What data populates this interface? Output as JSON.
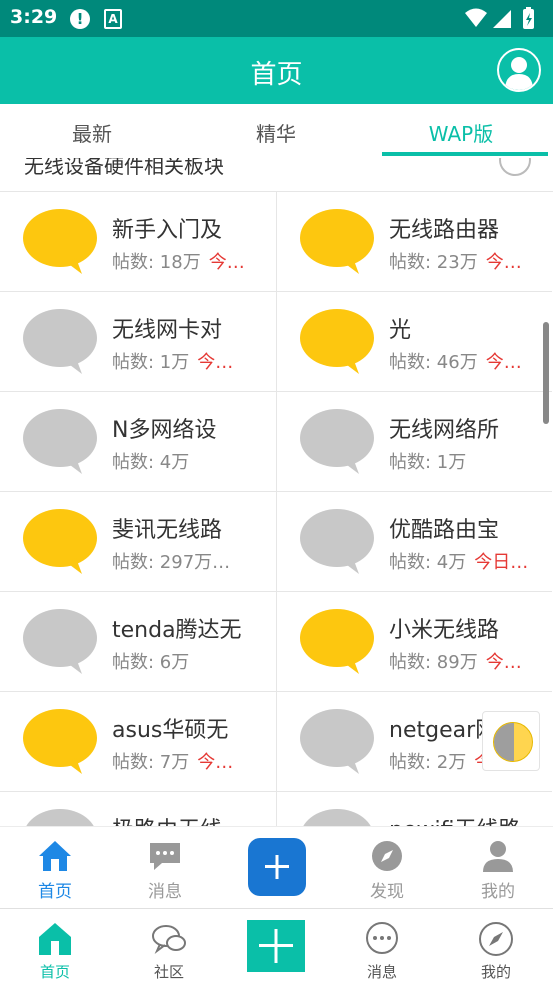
{
  "status_bar": {
    "time": "3:29",
    "alert_glyph": "!",
    "a_glyph": "A"
  },
  "header": {
    "title": "首页"
  },
  "tabs": [
    {
      "label": "最新",
      "active": false
    },
    {
      "label": "精华",
      "active": false
    },
    {
      "label": "WAP版",
      "active": true
    }
  ],
  "partial_row": {
    "text": "无线设备硬件相关板块"
  },
  "forums": [
    {
      "name": "新手入门及",
      "count": "帖数: 18万",
      "today": "今…",
      "color": "yellow"
    },
    {
      "name": "无线路由器",
      "count": "帖数: 23万",
      "today": "今…",
      "color": "yellow"
    },
    {
      "name": "无线网卡对",
      "count": "帖数: 1万",
      "today": "今…",
      "color": "gray"
    },
    {
      "name": "光",
      "count": "帖数: 46万",
      "today": "今…",
      "color": "yellow"
    },
    {
      "name": "N多网络设",
      "count": "帖数: 4万",
      "today": "",
      "color": "gray"
    },
    {
      "name": "无线网络所",
      "count": "帖数: 1万",
      "today": "",
      "color": "gray"
    },
    {
      "name": "斐讯无线路",
      "count": "帖数: 297万…",
      "today": "",
      "color": "yellow"
    },
    {
      "name": "优酷路由宝",
      "count": "帖数: 4万",
      "today": "今日…",
      "color": "gray"
    },
    {
      "name": "tenda腾达无",
      "count": "帖数: 6万",
      "today": "",
      "color": "gray"
    },
    {
      "name": "小米无线路",
      "count": "帖数: 89万",
      "today": "今…",
      "color": "yellow"
    },
    {
      "name": "asus华硕无",
      "count": "帖数: 7万",
      "today": "今…",
      "color": "yellow"
    },
    {
      "name": "netgear网件",
      "count": "帖数: 2万",
      "today": "今日…",
      "color": "gray"
    },
    {
      "name": "极路由无线",
      "count": "",
      "today": "",
      "color": "gray"
    },
    {
      "name": "newifi无线路",
      "count": "",
      "today": "",
      "color": "gray"
    }
  ],
  "colors": {
    "yellow": "#fdc70f",
    "gray": "#c8c8c8",
    "accent": "#0abfa8",
    "blue": "#1e88e5"
  },
  "nav1": [
    {
      "label": "首页",
      "icon": "home-icon",
      "active": true
    },
    {
      "label": "消息",
      "icon": "message-icon",
      "active": false
    },
    {
      "label": "",
      "icon": "add-icon",
      "active": false
    },
    {
      "label": "发现",
      "icon": "compass-icon",
      "active": false
    },
    {
      "label": "我的",
      "icon": "user-icon",
      "active": false
    }
  ],
  "nav2": [
    {
      "label": "首页",
      "icon": "home-icon",
      "active": true
    },
    {
      "label": "社区",
      "icon": "community-icon",
      "active": false
    },
    {
      "label": "",
      "icon": "add-icon",
      "active": false
    },
    {
      "label": "消息",
      "icon": "chat-icon",
      "active": false
    },
    {
      "label": "我的",
      "icon": "compass-icon",
      "active": false
    }
  ]
}
